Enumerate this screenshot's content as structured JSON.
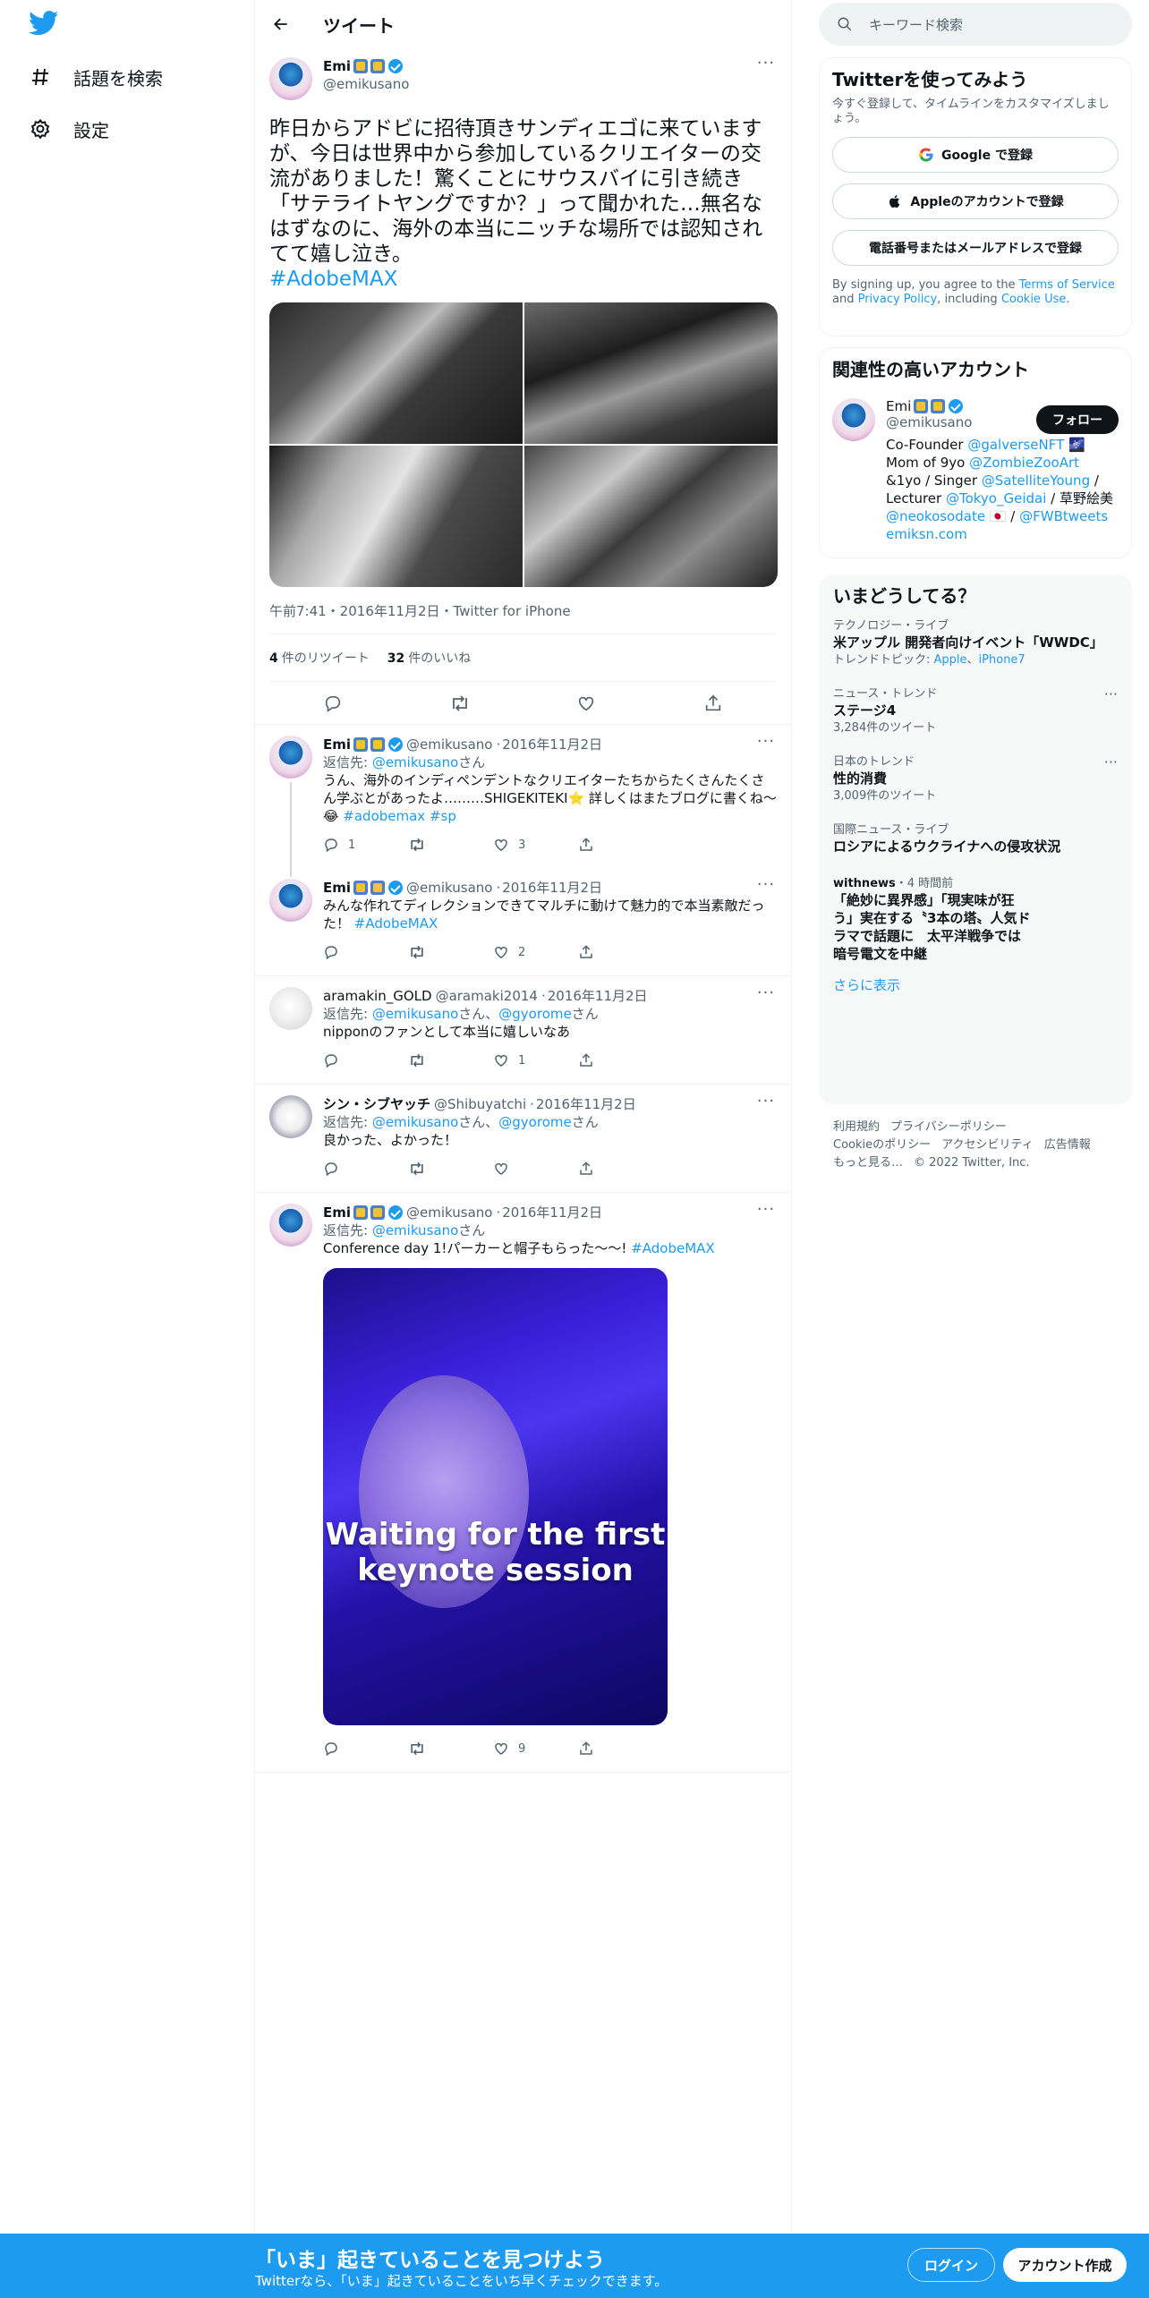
{
  "nav": {
    "explore_label": "話題を検索",
    "settings_label": "設定"
  },
  "header": {
    "title": "ツイート"
  },
  "focal": {
    "display_name": "Emi",
    "handle": "@emikusano",
    "text": "昨日からアドビに招待頂きサンディエゴに来ていますが、今日は世界中から参加しているクリエイターの交流がありました！驚くことにサウスバイに引き続き「サテライトヤングですか？」って聞かれた…無名なはずなのに、海外の本当にニッチな場所では認知されてて嬉し泣き。",
    "hashtag": "#AdobeMAX",
    "meta": "午前7:41・2016年11月2日・Twitter for iPhone",
    "retweets_count": "4",
    "retweets_label": "件のリツイート",
    "likes_count": "32",
    "likes_label": "件のいいね"
  },
  "replies": [
    {
      "name": "Emi",
      "handle": "@emikusano",
      "date": "2016年11月2日",
      "reply_to_prefix": "返信先: ",
      "reply_to_user": "@emikusano",
      "reply_to_suffix": "さん",
      "text": "うん、海外のインディペンデントなクリエイターたちからたくさんたくさん学ぶとがあったよ………SHIGEKITEKI⭐️ 詳しくはまたブログに書くね〜😂 ",
      "tags": "#adobemax #sp",
      "replies": "1",
      "retweets": "",
      "likes": "3"
    },
    {
      "name": "Emi",
      "handle": "@emikusano",
      "date": "2016年11月2日",
      "text": "みんな作れてディレクションできてマルチに動けて魅力的で本当素敵だった！ ",
      "tags": "#AdobeMAX",
      "replies": "",
      "retweets": "",
      "likes": "2"
    },
    {
      "name": "aramakin_GOLD",
      "handle": "@aramaki2014",
      "date": "2016年11月2日",
      "reply_to_prefix": "返信先: ",
      "reply_to_user": "@emikusano",
      "reply_to_mid": "さん、",
      "reply_to_user2": "@gyorome",
      "reply_to_suffix": "さん",
      "text": "nipponのファンとして本当に嬉しいなあ",
      "likes": "1"
    },
    {
      "name": "シン・シブヤッチ",
      "handle": "@Shibuyatchi",
      "date": "2016年11月2日",
      "reply_to_prefix": "返信先: ",
      "reply_to_user": "@emikusano",
      "reply_to_mid": "さん、",
      "reply_to_user2": "@gyorome",
      "reply_to_suffix": "さん",
      "text": "良かった、よかった！",
      "likes": ""
    },
    {
      "name": "Emi",
      "handle": "@emikusano",
      "date": "2016年11月2日",
      "reply_to_prefix": "返信先: ",
      "reply_to_user": "@emikusano",
      "reply_to_suffix": "さん",
      "text": "Conference day 1!パーカーと帽子もらった〜〜! ",
      "tags": "#AdobeMAX",
      "image_caption": "Waiting for the first keynote session",
      "likes": "9"
    }
  ],
  "search": {
    "placeholder": "キーワード検索"
  },
  "signup": {
    "title": "Twitterを使ってみよう",
    "subtitle": "今すぐ登録して、タイムラインをカスタマイズしましょう。",
    "google": "Google で登録",
    "apple": "Appleのアカウントで登録",
    "phone": "電話番号またはメールアドレスで登録",
    "legal_1": "By signing up, you agree to the ",
    "tos": "Terms of Service",
    "legal_2": " and ",
    "privacy": "Privacy Policy",
    "legal_3": ", including ",
    "cookie": "Cookie Use",
    "legal_4": "."
  },
  "related": {
    "title": "関連性の高いアカウント",
    "name": "Emi",
    "handle": "@emikusano",
    "follow": "フォロー",
    "bio_1": "Co-Founder ",
    "bio_l1": "@galverseNFT",
    "bio_2": " 🌌 Mom of 9yo ",
    "bio_l2": "@ZombieZooArt",
    "bio_3": " &1yo / Singer ",
    "bio_l3": "@SatelliteYoung",
    "bio_4": " / Lecturer ",
    "bio_l4": "@Tokyo_Geidai",
    "bio_5": " / 草野絵美 ",
    "bio_l5": "@neokosodate",
    "bio_6": " 🇯🇵 / ",
    "bio_l6": "@FWBtweets",
    "bio_l7": "emiksn.com"
  },
  "trends": {
    "title": "いまどうしてる？",
    "items": [
      {
        "cat": "テクノロジー・ライブ",
        "topic": "米アップル 開発者向けイベント「WWDC」",
        "extra_prefix": "トレンドトピック: ",
        "extra_l1": "Apple",
        "extra_sep": "、",
        "extra_l2": "iPhone7"
      },
      {
        "cat": "ニュース・トレンド",
        "topic": "ステージ4",
        "count": "3,284件のツイート"
      },
      {
        "cat": "日本のトレンド",
        "topic": "性的消費",
        "count": "3,009件のツイート"
      },
      {
        "cat": "国際ニュース・ライブ",
        "topic": "ロシアによるウクライナへの侵攻状況"
      },
      {
        "source": "withnews",
        "time": "・4 時間前",
        "topic": "「絶妙に異界感」「現実味が狂う」実在する〝3本の塔〟人気ドラマで話題に　太平洋戦争では暗号電文を中継"
      }
    ],
    "show_more": "さらに表示"
  },
  "footer": {
    "tos": "利用規約",
    "privacy": "プライバシーポリシー",
    "cookie": "Cookieのポリシー",
    "a11y": "アクセシビリティ",
    "ads": "広告情報",
    "more": "もっと見る…",
    "copyright": "© 2022 Twitter, Inc."
  },
  "bottom": {
    "title": "「いま」起きていることを見つけよう",
    "subtitle": "Twitterなら、「いま」起きていることをいち早くチェックできます。",
    "login": "ログイン",
    "signup": "アカウント作成"
  },
  "colors": {
    "accent": "#1d9bf0",
    "text": "#0f1419",
    "muted": "#536471"
  }
}
